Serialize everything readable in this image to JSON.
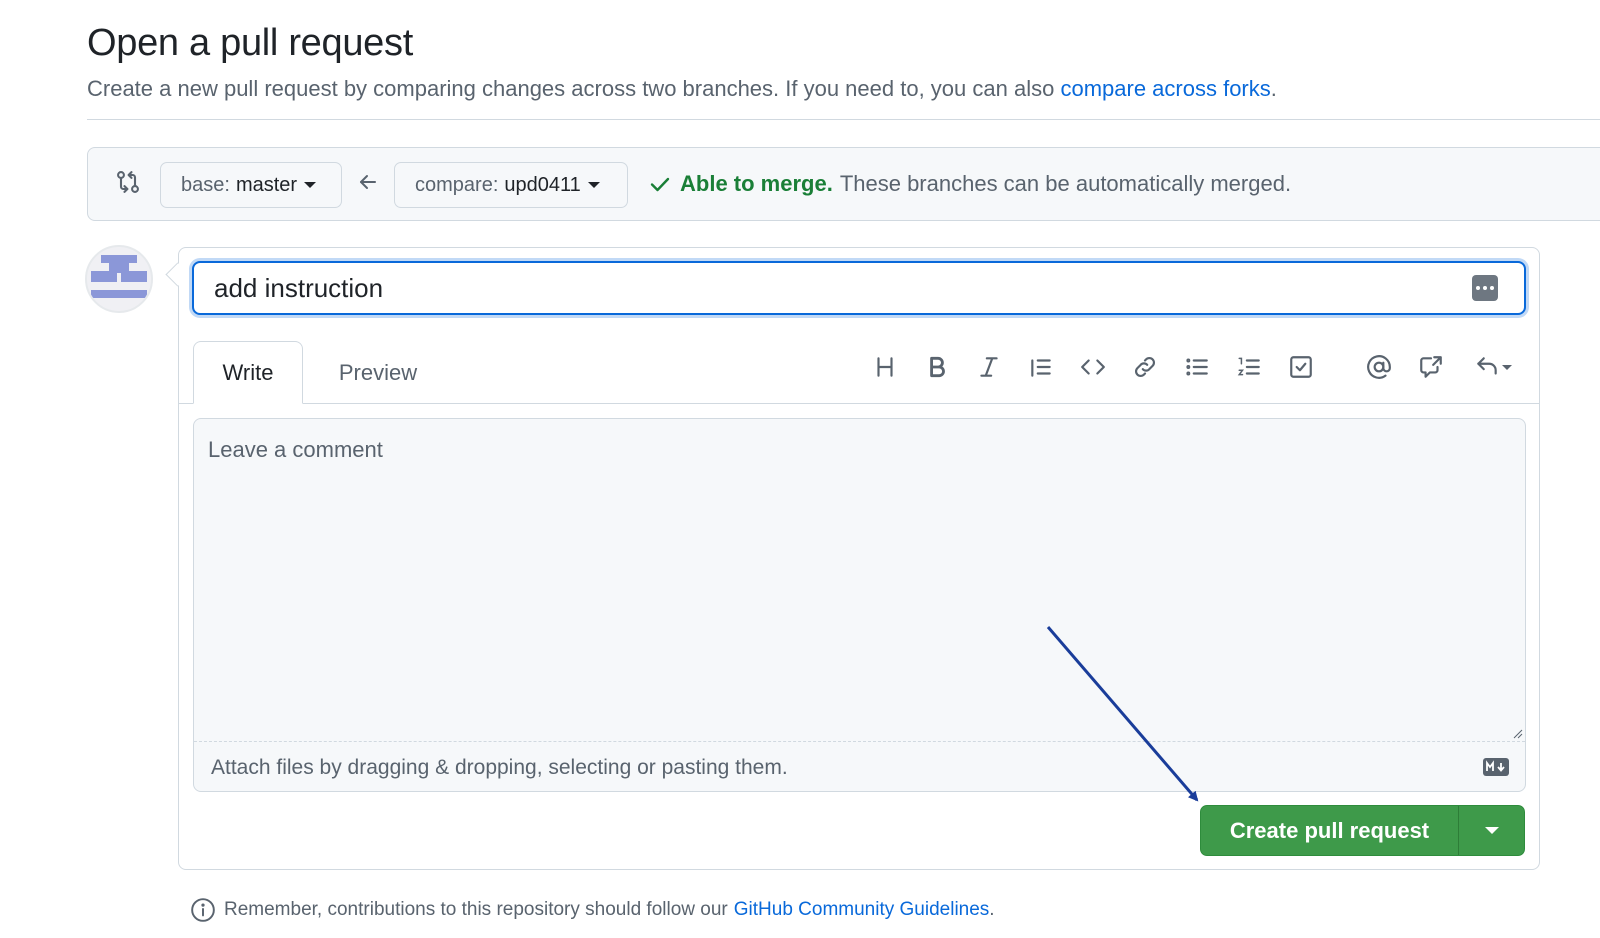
{
  "page": {
    "title": "Open a pull request",
    "subtitle_prefix": "Create a new pull request by comparing changes across two branches. If you need to, you can also",
    "subtitle_link": "compare across forks",
    "subtitle_suffix": "."
  },
  "compare": {
    "base_prefix": "base:",
    "base_branch": "master",
    "compare_prefix": "compare:",
    "compare_branch": "upd0411",
    "merge_ok": "Able to merge.",
    "merge_detail": "These branches can be automatically merged."
  },
  "form": {
    "title_value": "add instruction",
    "tabs": {
      "write": "Write",
      "preview": "Preview"
    },
    "comment_placeholder": "Leave a comment",
    "attach_text": "Attach files by dragging & dropping, selecting or pasting them.",
    "submit_label": "Create pull request"
  },
  "toolbar": {
    "icons": [
      "heading-icon",
      "bold-icon",
      "italic-icon",
      "quote-icon",
      "code-icon",
      "link-icon",
      "unordered-list-icon",
      "ordered-list-icon",
      "task-list-icon",
      "mention-icon",
      "cross-reference-icon",
      "reply-icon"
    ]
  },
  "footer": {
    "text": "Remember, contributions to this repository should follow our",
    "link": "GitHub Community Guidelines",
    "suffix": "."
  },
  "colors": {
    "accent_blue": "#0969da",
    "success_green": "#1a7f37",
    "button_green": "#3e9a4a",
    "annotation_arrow": "#1a3d9a"
  }
}
